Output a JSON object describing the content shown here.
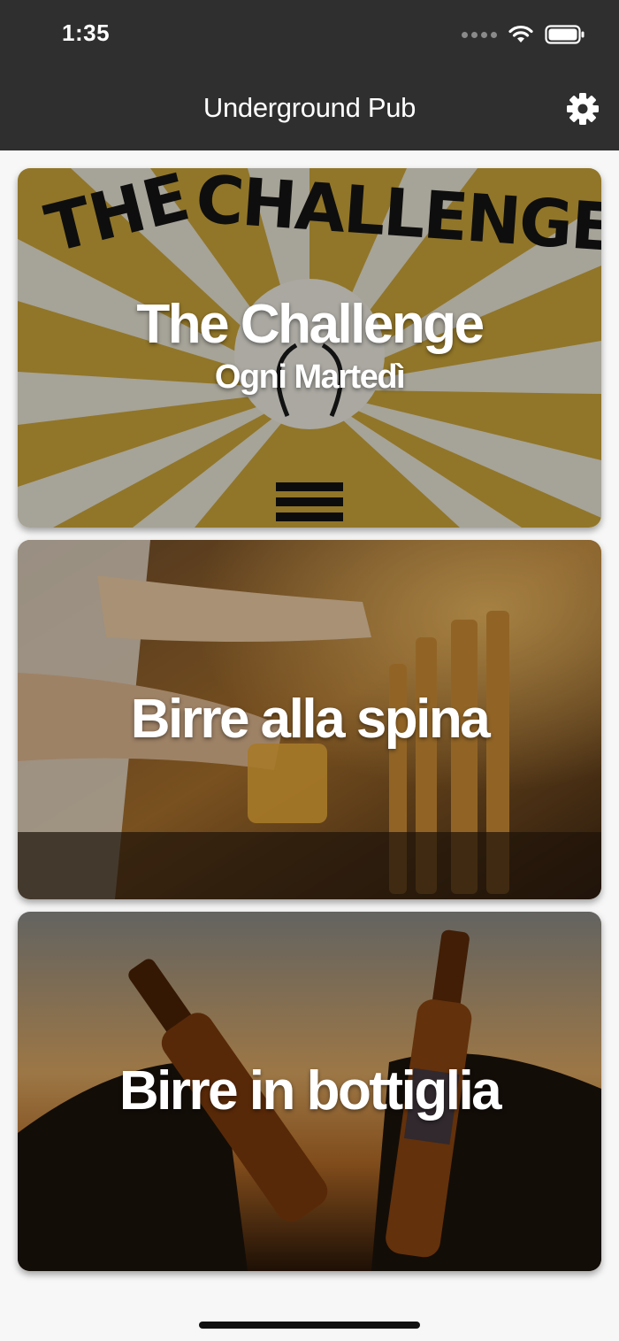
{
  "status_bar": {
    "time": "1:35"
  },
  "nav": {
    "title": "Underground Pub",
    "settings_icon": "gear-icon"
  },
  "cards": [
    {
      "title": "The Challenge",
      "subtitle": "Ogni Martedì",
      "background_lettering": "THE CHALLENGE"
    },
    {
      "title": "Birre alla spina"
    },
    {
      "title": "Birre in bottiglia"
    }
  ],
  "colors": {
    "bar_background": "#2f2f2f",
    "page_background": "#f7f7f7",
    "challenge_yellow": "#c9a43a"
  }
}
